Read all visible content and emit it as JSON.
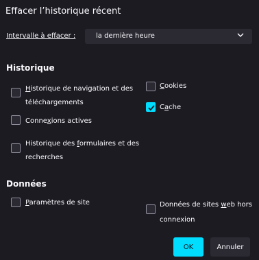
{
  "dialog": {
    "title": "Effacer l’historique récent",
    "range_label": "Intervalle à effacer :",
    "range_value": "la dernière heure",
    "history_heading": "Historique",
    "data_heading": "Données"
  },
  "history": {
    "nav_line1_pre": "",
    "nav_line1_u": "H",
    "nav_line1_post": "istorique de navigation et des",
    "nav_line2": "téléchargements",
    "nav_checked": false,
    "cookies_u": "C",
    "cookies_post": "ookies",
    "cookies_checked": false,
    "cache_pre": "C",
    "cache_u": "a",
    "cache_post": "che",
    "cache_checked": true,
    "sessions_pre": "Conne",
    "sessions_u": "x",
    "sessions_post": "ions actives",
    "sessions_checked": false,
    "forms_line1_pre": "Historique des ",
    "forms_line1_u": "f",
    "forms_line1_post": "ormulaires et des",
    "forms_line2": "recherches",
    "forms_checked": false
  },
  "data": {
    "site_settings_u": "P",
    "site_settings_post": "aramètres de site",
    "site_settings_checked": false,
    "offline_line1_pre": "Données de sites ",
    "offline_line1_u": "w",
    "offline_line1_post": "eb hors",
    "offline_line2": "connexion",
    "offline_checked": false
  },
  "buttons": {
    "ok": "OK",
    "cancel": "Annuler"
  },
  "colors": {
    "accent": "#00ddff",
    "background": "#1c1b22",
    "control": "#2b2a33"
  }
}
